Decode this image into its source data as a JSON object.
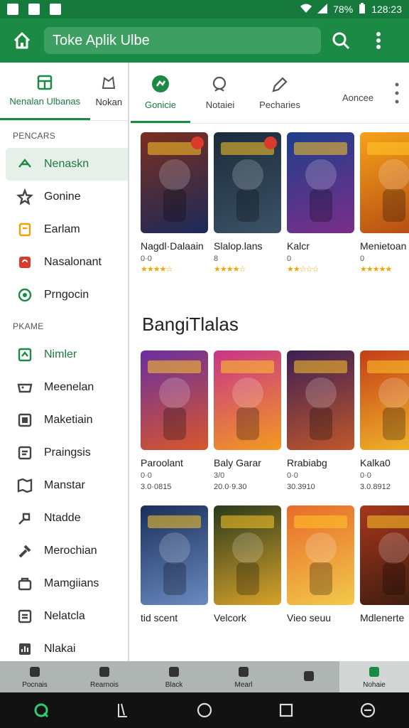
{
  "status": {
    "battery": "78%",
    "time": "128:23"
  },
  "appbar": {
    "title": "Toke Aplik Ulbe"
  },
  "sidebar": {
    "tabs": [
      {
        "label": "Nenalan Ulbanas"
      },
      {
        "label": "Nokan"
      }
    ],
    "section1": "PENCARS",
    "items1": [
      {
        "label": "Nenaskn",
        "icon": "game-controller-icon",
        "color": "#1b8a45"
      },
      {
        "label": "Gonine",
        "icon": "star-icon",
        "color": "#444"
      },
      {
        "label": "Earlam",
        "icon": "book-icon",
        "color": "#f2a100"
      },
      {
        "label": "Nasalonant",
        "icon": "gift-icon",
        "color": "#d93a2b"
      },
      {
        "label": "Prngocin",
        "icon": "circle-icon",
        "color": "#1b8a45"
      }
    ],
    "section2": "PKAME",
    "items2": [
      {
        "label": "Nimler",
        "icon": "download-icon",
        "color": "#1b8a45"
      },
      {
        "label": "Meenelan",
        "icon": "cart-icon",
        "color": "#444"
      },
      {
        "label": "Maketiain",
        "icon": "square-icon",
        "color": "#444"
      },
      {
        "label": "Praingsis",
        "icon": "list-icon",
        "color": "#444"
      },
      {
        "label": "Manstar",
        "icon": "map-icon",
        "color": "#444"
      },
      {
        "label": "Ntadde",
        "icon": "tag-icon",
        "color": "#444"
      },
      {
        "label": "Merochian",
        "icon": "hammer-icon",
        "color": "#444"
      },
      {
        "label": "Mamgiians",
        "icon": "bag-icon",
        "color": "#444"
      },
      {
        "label": "Nelatcla",
        "icon": "document-icon",
        "color": "#444"
      },
      {
        "label": "Nlakai",
        "icon": "chart-icon",
        "color": "#444"
      }
    ]
  },
  "tabs": [
    {
      "label": "Gonicie"
    },
    {
      "label": "Notaiei"
    },
    {
      "label": "Pecharies"
    },
    {
      "label": "Aoncee"
    }
  ],
  "featured": [
    {
      "title": "Nagdl·Dalaain",
      "sub": "0·0",
      "stars": "★★★★☆",
      "c1": "#7a2f1e",
      "c2": "#1b2a5a"
    },
    {
      "title": "Slalop.lans",
      "sub": "8",
      "stars": "★★★★☆",
      "c1": "#1c2b3a",
      "c2": "#3b5266"
    },
    {
      "title": "Kalcr",
      "sub": "0",
      "stars": "★★☆☆☆",
      "c1": "#1e3f8a",
      "c2": "#7a2e8a"
    },
    {
      "title": "Menietoan",
      "sub": "0",
      "stars": "★★★★★",
      "c1": "#f6a21a",
      "c2": "#b34a12"
    }
  ],
  "section_title": "BangiTlalas",
  "row2": [
    {
      "title": "Paroolant",
      "sub": "0·0",
      "sub2": "3.0·0815",
      "c1": "#6a2fa0",
      "c2": "#d8572a"
    },
    {
      "title": "Baly Garar",
      "sub": "3/0",
      "sub2": "20.0·9.30",
      "c1": "#c8348a",
      "c2": "#f29a1f"
    },
    {
      "title": "Rrabiabg",
      "sub": "0·0",
      "sub2": "30.3910",
      "c1": "#3c1f55",
      "c2": "#c0572a"
    },
    {
      "title": "Kalka0",
      "sub": "0·0",
      "sub2": "3.0.8912",
      "c1": "#c43d18",
      "c2": "#f2b92a"
    }
  ],
  "row3": [
    {
      "title": "tid scent",
      "c1": "#1a2f5a",
      "c2": "#6a8ac0"
    },
    {
      "title": "Velcork",
      "c1": "#2a3a1c",
      "c2": "#d8a22a"
    },
    {
      "title": "Vieo seuu",
      "c1": "#e86a2a",
      "c2": "#f2c94a"
    },
    {
      "title": "Mdlenerte",
      "c1": "#a8361c",
      "c2": "#3a1c10"
    }
  ],
  "bottomnav": [
    {
      "label": "Pocnais"
    },
    {
      "label": "Rearnois"
    },
    {
      "label": "Black"
    },
    {
      "label": "Mearl"
    },
    {
      "label": ""
    },
    {
      "label": "Nohaie"
    }
  ]
}
